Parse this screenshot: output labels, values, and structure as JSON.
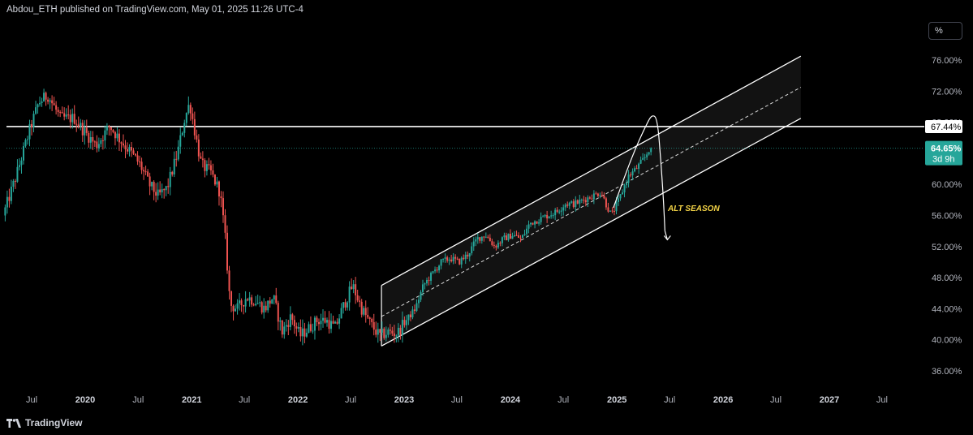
{
  "header": {
    "publish_line": "Abdou_ETH published on TradingView.com, May 01, 2025 11:26 UTC-4"
  },
  "toolbar": {
    "scale_mode_label": "%"
  },
  "branding": {
    "name": "TradingView"
  },
  "colors": {
    "background": "#000000",
    "up_candle": "#26a69a",
    "down_candle": "#ef5350",
    "channel_line": "#ffffff",
    "current_tag": "#26a69a",
    "annotation_text": "#f5d547"
  },
  "chart_data": {
    "type": "candlestick",
    "y_unit": "%",
    "y_axis": {
      "range": [
        33.0,
        80.0
      ],
      "ticks": [
        "76.00%",
        "72.00%",
        "68.00%",
        "64.00%",
        "60.00%",
        "56.00%",
        "52.00%",
        "48.00%",
        "44.00%",
        "40.00%",
        "36.00%"
      ],
      "tick_values": [
        76,
        72,
        68,
        64,
        60,
        56,
        52,
        48,
        44,
        40,
        36
      ]
    },
    "x_axis": {
      "range": [
        "2019-04-01",
        "2027-10-01"
      ],
      "labels": [
        {
          "text": "Jul",
          "date": "2019-07-01",
          "year": false
        },
        {
          "text": "2020",
          "date": "2020-01-01",
          "year": true
        },
        {
          "text": "Jul",
          "date": "2020-07-01",
          "year": false
        },
        {
          "text": "2021",
          "date": "2021-01-01",
          "year": true
        },
        {
          "text": "Jul",
          "date": "2021-07-01",
          "year": false
        },
        {
          "text": "2022",
          "date": "2022-01-01",
          "year": true
        },
        {
          "text": "Jul",
          "date": "2022-07-01",
          "year": false
        },
        {
          "text": "2023",
          "date": "2023-01-01",
          "year": true
        },
        {
          "text": "Jul",
          "date": "2023-07-01",
          "year": false
        },
        {
          "text": "2024",
          "date": "2024-01-01",
          "year": true
        },
        {
          "text": "Jul",
          "date": "2024-07-01",
          "year": false
        },
        {
          "text": "2025",
          "date": "2025-01-01",
          "year": true
        },
        {
          "text": "Jul",
          "date": "2025-07-01",
          "year": false
        },
        {
          "text": "2026",
          "date": "2026-01-01",
          "year": true
        },
        {
          "text": "Jul",
          "date": "2026-07-01",
          "year": false
        },
        {
          "text": "2027",
          "date": "2027-01-01",
          "year": true
        },
        {
          "text": "Jul",
          "date": "2027-07-01",
          "year": false
        }
      ]
    },
    "price_series": {
      "start": "2019-04-01",
      "end": "2025-04-30",
      "keypoints": [
        [
          "2019-04-01",
          56.0
        ],
        [
          "2019-05-15",
          61.0
        ],
        [
          "2019-07-01",
          67.0
        ],
        [
          "2019-08-01",
          70.5
        ],
        [
          "2019-09-01",
          71.5
        ],
        [
          "2019-10-15",
          68.5
        ],
        [
          "2019-12-01",
          68.5
        ],
        [
          "2020-01-01",
          67.0
        ],
        [
          "2020-02-15",
          65.0
        ],
        [
          "2020-04-01",
          67.5
        ],
        [
          "2020-05-01",
          66.0
        ],
        [
          "2020-06-15",
          64.0
        ],
        [
          "2020-07-15",
          62.5
        ],
        [
          "2020-08-15",
          60.0
        ],
        [
          "2020-09-15",
          58.5
        ],
        [
          "2020-10-15",
          59.5
        ],
        [
          "2020-11-20",
          64.0
        ],
        [
          "2020-12-15",
          68.5
        ],
        [
          "2021-01-01",
          70.5
        ],
        [
          "2021-01-20",
          66.5
        ],
        [
          "2021-02-10",
          62.5
        ],
        [
          "2021-03-15",
          61.5
        ],
        [
          "2021-04-15",
          59.0
        ],
        [
          "2021-05-01",
          54.0
        ],
        [
          "2021-05-20",
          44.5
        ],
        [
          "2021-06-15",
          44.0
        ],
        [
          "2021-07-15",
          45.5
        ],
        [
          "2021-08-15",
          45.0
        ],
        [
          "2021-09-15",
          44.0
        ],
        [
          "2021-10-15",
          45.5
        ],
        [
          "2021-11-15",
          41.0
        ],
        [
          "2021-12-15",
          43.0
        ],
        [
          "2022-01-15",
          40.5
        ],
        [
          "2022-02-15",
          41.5
        ],
        [
          "2022-03-15",
          42.5
        ],
        [
          "2022-04-15",
          42.5
        ],
        [
          "2022-05-15",
          41.5
        ],
        [
          "2022-06-15",
          44.5
        ],
        [
          "2022-07-15",
          47.0
        ],
        [
          "2022-08-15",
          44.0
        ],
        [
          "2022-09-15",
          42.0
        ],
        [
          "2022-10-15",
          40.5
        ],
        [
          "2022-11-15",
          41.0
        ],
        [
          "2022-12-15",
          40.8
        ],
        [
          "2023-01-15",
          42.5
        ],
        [
          "2023-02-15",
          44.0
        ],
        [
          "2023-03-15",
          47.0
        ],
        [
          "2023-04-15",
          48.5
        ],
        [
          "2023-05-15",
          50.0
        ],
        [
          "2023-06-15",
          50.5
        ],
        [
          "2023-07-15",
          50.0
        ],
        [
          "2023-08-15",
          51.0
        ],
        [
          "2023-09-15",
          53.0
        ],
        [
          "2023-10-15",
          53.5
        ],
        [
          "2023-11-15",
          52.0
        ],
        [
          "2023-12-15",
          53.0
        ],
        [
          "2024-01-15",
          53.5
        ],
        [
          "2024-02-15",
          53.0
        ],
        [
          "2024-03-15",
          55.0
        ],
        [
          "2024-04-15",
          55.5
        ],
        [
          "2024-05-15",
          56.0
        ],
        [
          "2024-06-15",
          56.5
        ],
        [
          "2024-07-15",
          57.5
        ],
        [
          "2024-08-15",
          57.5
        ],
        [
          "2024-09-15",
          58.0
        ],
        [
          "2024-10-15",
          58.5
        ],
        [
          "2024-11-15",
          59.0
        ],
        [
          "2024-12-01",
          57.5
        ],
        [
          "2024-12-20",
          56.0
        ],
        [
          "2025-01-15",
          58.0
        ],
        [
          "2025-02-15",
          61.0
        ],
        [
          "2025-03-15",
          62.0
        ],
        [
          "2025-04-15",
          63.5
        ],
        [
          "2025-04-30",
          64.65
        ]
      ]
    },
    "horizontal_level": {
      "value": 67.44,
      "label": "67.44%"
    },
    "current_price": {
      "value": 64.65,
      "label": "64.65%",
      "countdown": "3d 9h"
    },
    "parallel_channel": {
      "upper": [
        [
          "2022-10-15",
          47.0
        ],
        [
          "2026-09-25",
          76.5
        ]
      ],
      "middle": [
        [
          "2022-10-15",
          43.0
        ],
        [
          "2026-09-25",
          72.5
        ]
      ],
      "lower": [
        [
          "2022-10-15",
          39.2
        ],
        [
          "2026-09-25",
          68.5
        ]
      ]
    },
    "projection_curve": [
      [
        "2024-12-20",
        57.0
      ],
      [
        "2025-02-01",
        61.5
      ],
      [
        "2025-03-10",
        65.0
      ],
      [
        "2025-04-10",
        67.5
      ],
      [
        "2025-05-01",
        69.0
      ],
      [
        "2025-05-20",
        68.5
      ],
      [
        "2025-06-01",
        63.0
      ],
      [
        "2025-06-10",
        58.0
      ],
      [
        "2025-06-15",
        54.0
      ]
    ],
    "annotations": [
      {
        "text": "ALT SEASON",
        "date": "2025-06-25",
        "value": 57.0
      }
    ]
  }
}
